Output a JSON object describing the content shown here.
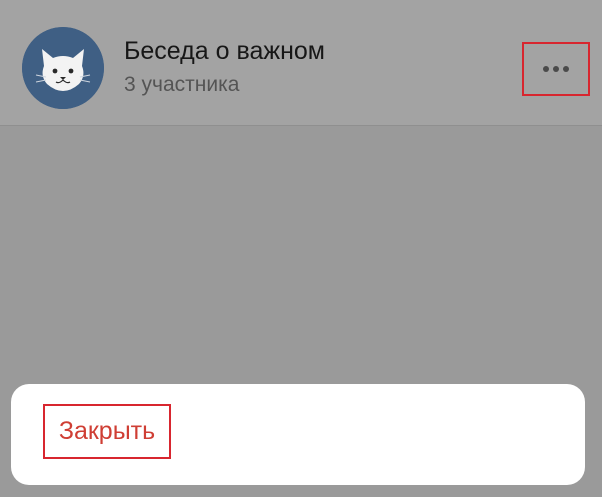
{
  "conversation": {
    "title": "Беседа о важном",
    "members": "3 участника",
    "avatar_icon": "white-cat-face-icon",
    "avatar_color": "#3f5f84"
  },
  "header": {
    "menu_icon": "more-dots-icon"
  },
  "action_sheet": {
    "close_label": "Закрыть",
    "close_color": "#cf3e34"
  },
  "highlight_color": "#d8262f"
}
